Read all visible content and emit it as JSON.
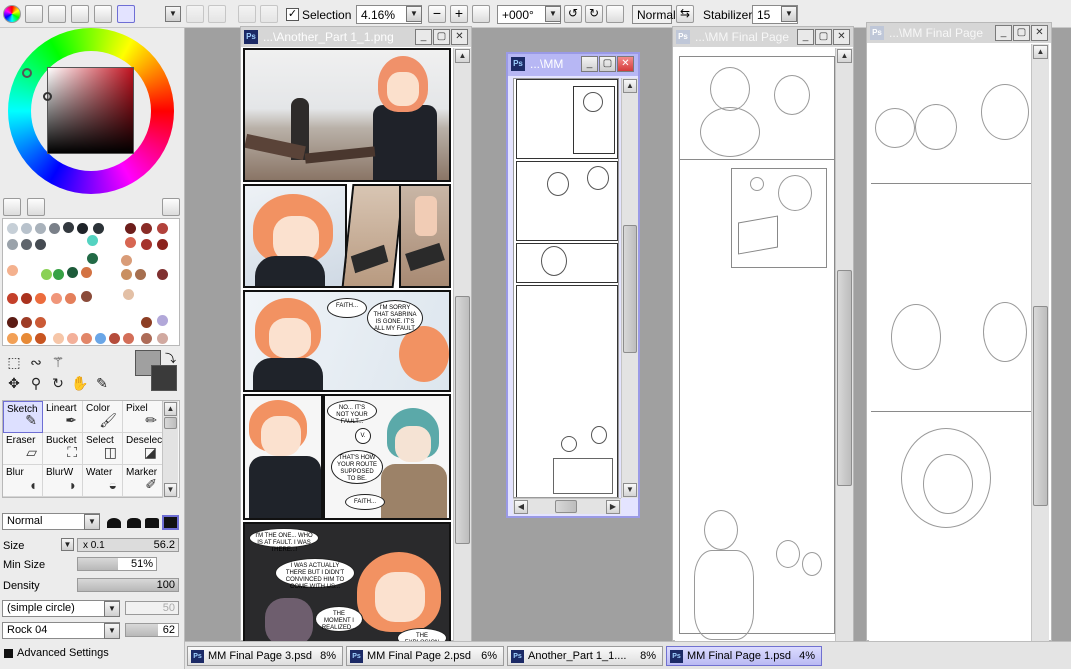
{
  "toolbar": {
    "selection_label": "Selection",
    "selection_checked": true,
    "zoom": "4.16%",
    "rotation": "+000°",
    "blend_mode": "Normal",
    "stabilizer_label": "Stabilizer",
    "stabilizer_value": "15"
  },
  "tools": {
    "brushes": [
      {
        "label": "Sketch",
        "icon": "pencil-icon",
        "active": true
      },
      {
        "label": "Lineart",
        "icon": "pen-icon",
        "active": false
      },
      {
        "label": "Color",
        "icon": "brush-icon",
        "active": false
      },
      {
        "label": "Pixel",
        "icon": "pixel-pen-icon",
        "active": false
      },
      {
        "label": "Eraser",
        "icon": "eraser-icon",
        "active": false
      },
      {
        "label": "Bucket",
        "icon": "bucket-icon",
        "active": false
      },
      {
        "label": "Select",
        "icon": "select-brush-icon",
        "active": false
      },
      {
        "label": "Deselect",
        "icon": "deselect-brush-icon",
        "active": false
      },
      {
        "label": "Blur",
        "icon": "blur-icon",
        "active": false
      },
      {
        "label": "BlurW",
        "icon": "blurw-icon",
        "active": false
      },
      {
        "label": "Water",
        "icon": "water-icon",
        "active": false
      },
      {
        "label": "Marker",
        "icon": "marker-icon",
        "active": false
      }
    ]
  },
  "brush_settings": {
    "blend_mode": "Normal",
    "size_label": "Size",
    "size_multiplier": "x 0.1",
    "size_value": "56.2",
    "min_size_label": "Min Size",
    "min_size_value": "51%",
    "min_size_level": 0.51,
    "density_label": "Density",
    "density_value": "100",
    "density_level": 1.0,
    "shape": "(simple circle)",
    "shape_value": "50",
    "texture": "Rock 04",
    "texture_value": "62",
    "advanced_label": "Advanced Settings"
  },
  "windows": {
    "another_part": {
      "title": "...\\Another_Part 1_1.png"
    },
    "mm_small": {
      "title": "...\\MM"
    },
    "mm_final_a": {
      "title": "...\\MM Final Page"
    },
    "mm_final_b": {
      "title": "...\\MM Final Page"
    }
  },
  "comic_text": {
    "b1": "FAITH...",
    "b2": "I'M SORRY THAT SABRINA IS GONE. IT'S ALL MY FAULT.",
    "b3": "NO... IT'S NOT YOUR FAULT...",
    "b4": "V.",
    "b5": "THAT'S HOW YOUR ROUTE SUPPOSED TO BE.",
    "b6": "FAITH...",
    "b7": "I'M THE ONE... WHO IS AT FAULT. I WAS THERE...!",
    "b8": "I WAS ACTUALLY THERE BUT I DIDN'T CONVINCED HIM TO COME WITH US...",
    "b9": "THE MOMENT I REALIZED...",
    "b10": "THE EXPLOSION SETS OFF..."
  },
  "taskbar": [
    {
      "name": "MM Final Page 3.psd",
      "pct": "8%",
      "active": false
    },
    {
      "name": "MM Final Page 2.psd",
      "pct": "6%",
      "active": false
    },
    {
      "name": "Another_Part 1_1....",
      "pct": "8%",
      "active": false
    },
    {
      "name": "MM Final Page 1.psd",
      "pct": "4%",
      "active": true
    }
  ],
  "colors": {
    "accent": "#7070d0",
    "hair": "#f48a5a",
    "main_color": "#a0a0a0",
    "sub_color": "#3a3a3a"
  }
}
